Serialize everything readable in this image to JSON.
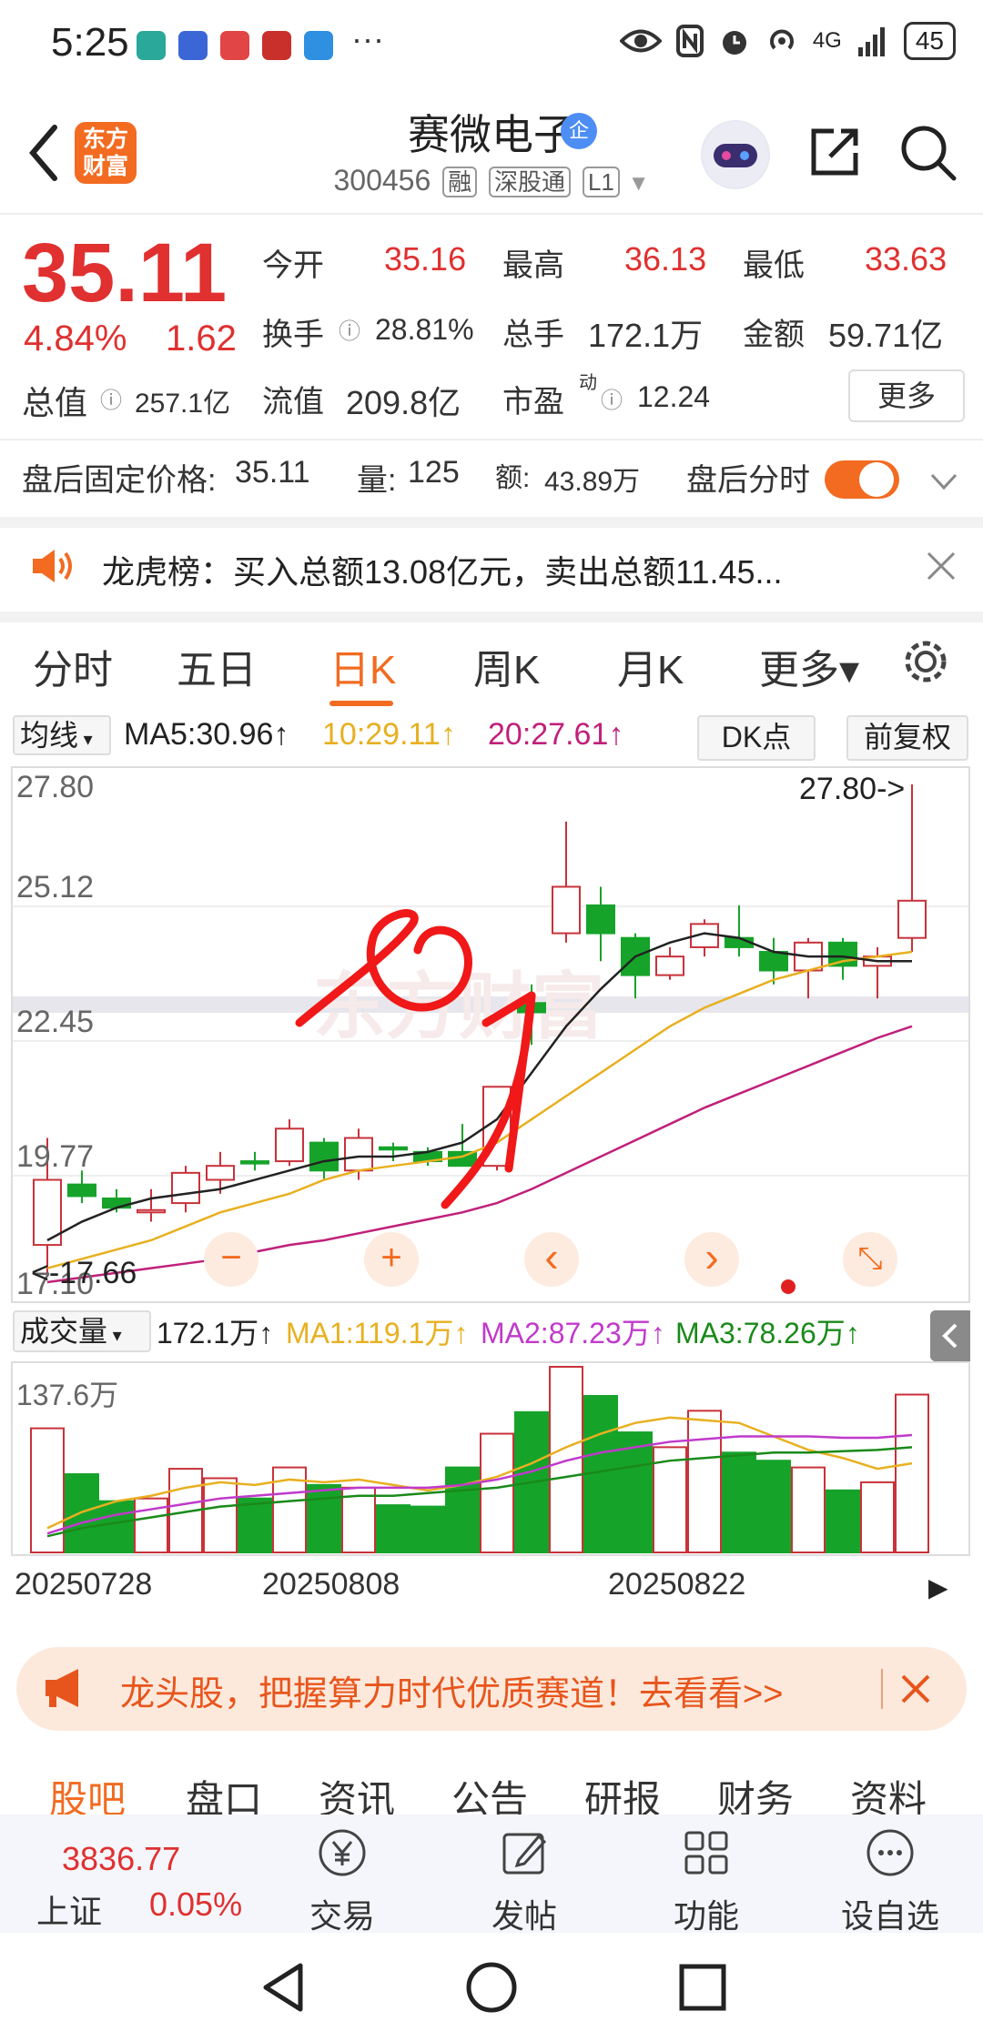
{
  "status": {
    "time": "5:25",
    "more": "···",
    "network": "4G",
    "battery": "45",
    "app_icon_colors": [
      "#2aa89a",
      "#3b66d6",
      "#e24545",
      "#c9302c",
      "#2f8fe0"
    ]
  },
  "header": {
    "logo_line1": "东方",
    "logo_line2": "财富",
    "stock_name": "赛微电子",
    "verified_badge": "企",
    "code": "300456",
    "tags": [
      "融",
      "深股通",
      "L1"
    ]
  },
  "quote": {
    "price": "35.11",
    "pct": "4.84%",
    "change": "1.62",
    "total_cap_label": "总值",
    "total_cap": "257.1亿",
    "open_label": "今开",
    "open": "35.16",
    "high_label": "最高",
    "high": "36.13",
    "low_label": "最低",
    "low": "33.63",
    "turnover_label": "换手",
    "turnover": "28.81%",
    "volume_label": "总手",
    "volume": "172.1万",
    "amount_label": "金额",
    "amount": "59.71亿",
    "float_cap_label": "流值",
    "float_cap": "209.8亿",
    "pe_label": "市盈",
    "pe_sup": "动",
    "pe": "12.24",
    "more_label": "更多"
  },
  "after_hours": {
    "price_label": "盘后固定价格:",
    "price": "35.11",
    "vol_label": "量:",
    "vol": "125",
    "amt_label": "额:",
    "amt": "43.89万",
    "toggle_label": "盘后分时",
    "toggle_on": true
  },
  "notice": {
    "text": "龙虎榜：买入总额13.08亿元，卖出总额11.45..."
  },
  "tabs": [
    "分时",
    "五日",
    "日K",
    "周K",
    "月K",
    "更多▾"
  ],
  "active_tab": "日K",
  "ma_bar": {
    "select_label": "均线",
    "ma5": "MA5:30.96↑",
    "ma10": "10:29.11↑",
    "ma20": "20:27.61↑",
    "dk_label": "DK点",
    "adjust_label": "前复权",
    "colors": {
      "ma5": "#222222",
      "ma10": "#e8b020",
      "ma20": "#c0207a"
    }
  },
  "kline": {
    "y_labels": [
      "27.80",
      "25.12",
      "22.45",
      "19.77",
      "17.10"
    ],
    "y_range": [
      17.1,
      27.8
    ],
    "max_label": "27.80->",
    "min_label": "<-17.66",
    "watermark": "东方财富",
    "controls": [
      "−",
      "+",
      "‹",
      "›",
      "⤡"
    ]
  },
  "volume_bar": {
    "select_label": "成交量",
    "total": "172.1万↑",
    "ma1": "MA1:119.1万↑",
    "ma2": "MA2:87.23万↑",
    "ma3": "MA3:78.26万↑",
    "max_label": "137.6万",
    "colors": {
      "ma1": "#e8b020",
      "ma2": "#c03acb",
      "ma3": "#1a8a1a"
    }
  },
  "dates": [
    "20250728",
    "20250808",
    "20250822"
  ],
  "chart_data": {
    "type": "candlestick",
    "ylim": [
      17.1,
      27.8
    ],
    "candles": [
      {
        "o": 17.9,
        "h": 20.2,
        "l": 17.3,
        "c": 19.3
      },
      {
        "o": 19.2,
        "h": 19.5,
        "l": 18.8,
        "c": 18.95
      },
      {
        "o": 18.9,
        "h": 19.1,
        "l": 18.6,
        "c": 18.7
      },
      {
        "o": 18.6,
        "h": 19.1,
        "l": 18.4,
        "c": 18.65
      },
      {
        "o": 18.8,
        "h": 19.6,
        "l": 18.6,
        "c": 19.45
      },
      {
        "o": 19.3,
        "h": 19.9,
        "l": 19.0,
        "c": 19.6
      },
      {
        "o": 19.7,
        "h": 19.9,
        "l": 19.5,
        "c": 19.65
      },
      {
        "o": 19.7,
        "h": 20.6,
        "l": 19.6,
        "c": 20.4
      },
      {
        "o": 20.1,
        "h": 20.2,
        "l": 19.3,
        "c": 19.5
      },
      {
        "o": 19.5,
        "h": 20.4,
        "l": 19.3,
        "c": 20.2
      },
      {
        "o": 20.0,
        "h": 20.1,
        "l": 19.7,
        "c": 19.95
      },
      {
        "o": 19.9,
        "h": 20.0,
        "l": 19.6,
        "c": 19.7
      },
      {
        "o": 19.9,
        "h": 20.5,
        "l": 19.6,
        "c": 19.6
      },
      {
        "o": 19.6,
        "h": 21.3,
        "l": 19.5,
        "c": 21.3
      },
      {
        "o": 23.1,
        "h": 23.5,
        "l": 22.2,
        "c": 22.9
      },
      {
        "o": 24.6,
        "h": 27.0,
        "l": 24.4,
        "c": 25.6
      },
      {
        "o": 25.2,
        "h": 25.6,
        "l": 24.0,
        "c": 24.6
      },
      {
        "o": 24.5,
        "h": 24.6,
        "l": 23.2,
        "c": 23.7
      },
      {
        "o": 23.7,
        "h": 24.3,
        "l": 23.6,
        "c": 24.1
      },
      {
        "o": 24.3,
        "h": 24.9,
        "l": 24.1,
        "c": 24.8
      },
      {
        "o": 24.5,
        "h": 25.2,
        "l": 24.1,
        "c": 24.3
      },
      {
        "o": 24.2,
        "h": 24.5,
        "l": 23.5,
        "c": 23.8
      },
      {
        "o": 23.8,
        "h": 24.5,
        "l": 23.2,
        "c": 24.4
      },
      {
        "o": 24.4,
        "h": 24.5,
        "l": 23.6,
        "c": 23.9
      },
      {
        "o": 23.9,
        "h": 24.3,
        "l": 23.2,
        "c": 24.1
      },
      {
        "o": 24.5,
        "h": 27.8,
        "l": 24.2,
        "c": 25.3
      }
    ],
    "ma5": [
      18.0,
      18.4,
      18.7,
      18.9,
      19.0,
      19.1,
      19.3,
      19.5,
      19.7,
      19.8,
      19.8,
      19.9,
      20.1,
      20.6,
      21.6,
      22.6,
      23.4,
      24.1,
      24.4,
      24.6,
      24.5,
      24.2,
      24.1,
      24.1,
      24.0,
      24.0
    ],
    "ma10": [
      17.4,
      17.6,
      17.8,
      18.0,
      18.3,
      18.6,
      18.8,
      19.0,
      19.3,
      19.5,
      19.6,
      19.7,
      19.8,
      20.1,
      20.6,
      21.1,
      21.6,
      22.1,
      22.6,
      23.0,
      23.3,
      23.6,
      23.8,
      24.0,
      24.1,
      24.2
    ],
    "ma20": [
      17.1,
      17.2,
      17.3,
      17.4,
      17.5,
      17.6,
      17.75,
      17.9,
      18.0,
      18.15,
      18.3,
      18.45,
      18.6,
      18.8,
      19.1,
      19.45,
      19.8,
      20.15,
      20.5,
      20.85,
      21.15,
      21.45,
      21.75,
      22.05,
      22.35,
      22.6
    ],
    "volume": {
      "ylim": [
        0,
        137.6
      ],
      "values": [
        92,
        58,
        38,
        40,
        62,
        55,
        40,
        63,
        50,
        48,
        35,
        34,
        63,
        88,
        104,
        137.6,
        116,
        89,
        78,
        105,
        74,
        68,
        63,
        46,
        52,
        117
      ],
      "ma1": [
        18,
        30,
        38,
        42,
        48,
        52,
        50,
        54,
        52,
        54,
        50,
        46,
        50,
        56,
        66,
        78,
        88,
        96,
        100,
        98,
        96,
        86,
        76,
        70,
        62,
        66
      ],
      "ma2": [
        14,
        22,
        28,
        32,
        36,
        40,
        42,
        44,
        46,
        48,
        48,
        48,
        50,
        54,
        60,
        68,
        74,
        78,
        82,
        84,
        86,
        86,
        86,
        85,
        85,
        87
      ],
      "ma3": [
        12,
        18,
        22,
        26,
        30,
        34,
        36,
        38,
        40,
        42,
        42,
        44,
        46,
        48,
        52,
        56,
        60,
        64,
        68,
        70,
        72,
        74,
        74,
        75,
        76,
        78
      ]
    },
    "annotation": "handdrawn-red-circle-and-arrow"
  },
  "banner": {
    "text": "龙头股，把握算力时代优质赛道！去看看>>"
  },
  "subtabs": [
    "股吧",
    "盘口",
    "资讯",
    "公告",
    "研报",
    "财务",
    "资料"
  ],
  "active_subtab": "股吧",
  "bottom": {
    "index_value": "3836.77",
    "index_name": "上证",
    "index_pct": "0.05%",
    "nav": [
      "交易",
      "发帖",
      "功能",
      "设自选"
    ]
  }
}
